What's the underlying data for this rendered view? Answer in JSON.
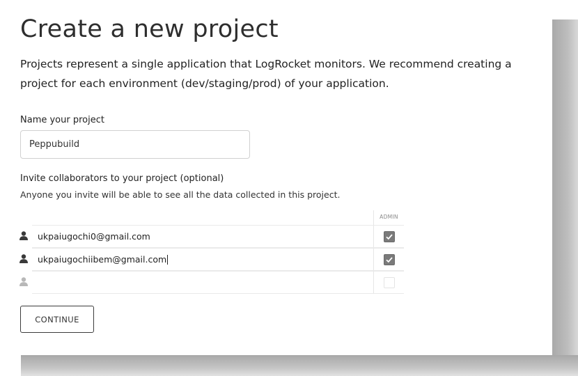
{
  "header": {
    "title": "Create a new project",
    "intro": "Projects represent a single application that LogRocket monitors. We recommend creating a project for each environment (dev/staging/prod) of your application."
  },
  "project": {
    "name_label": "Name your project",
    "name_value": "Peppubuild"
  },
  "collaborators": {
    "label": "Invite collaborators to your project (optional)",
    "description": "Anyone you invite will be able to see all the data collected in this project.",
    "admin_header": "ADMIN",
    "rows": [
      {
        "email": "ukpaiugochi0@gmail.com",
        "admin": true,
        "icon": "user-icon"
      },
      {
        "email": "ukpaiugochiibem@gmail.com",
        "admin": true,
        "icon": "user-icon"
      },
      {
        "email": "",
        "admin": false,
        "icon": "user-icon"
      }
    ]
  },
  "actions": {
    "continue_label": "CONTINUE"
  },
  "colors": {
    "icon_dark": "#3a3a3a",
    "icon_light": "#b8b8b8",
    "checkbox_checked": "#7a7a7a"
  }
}
